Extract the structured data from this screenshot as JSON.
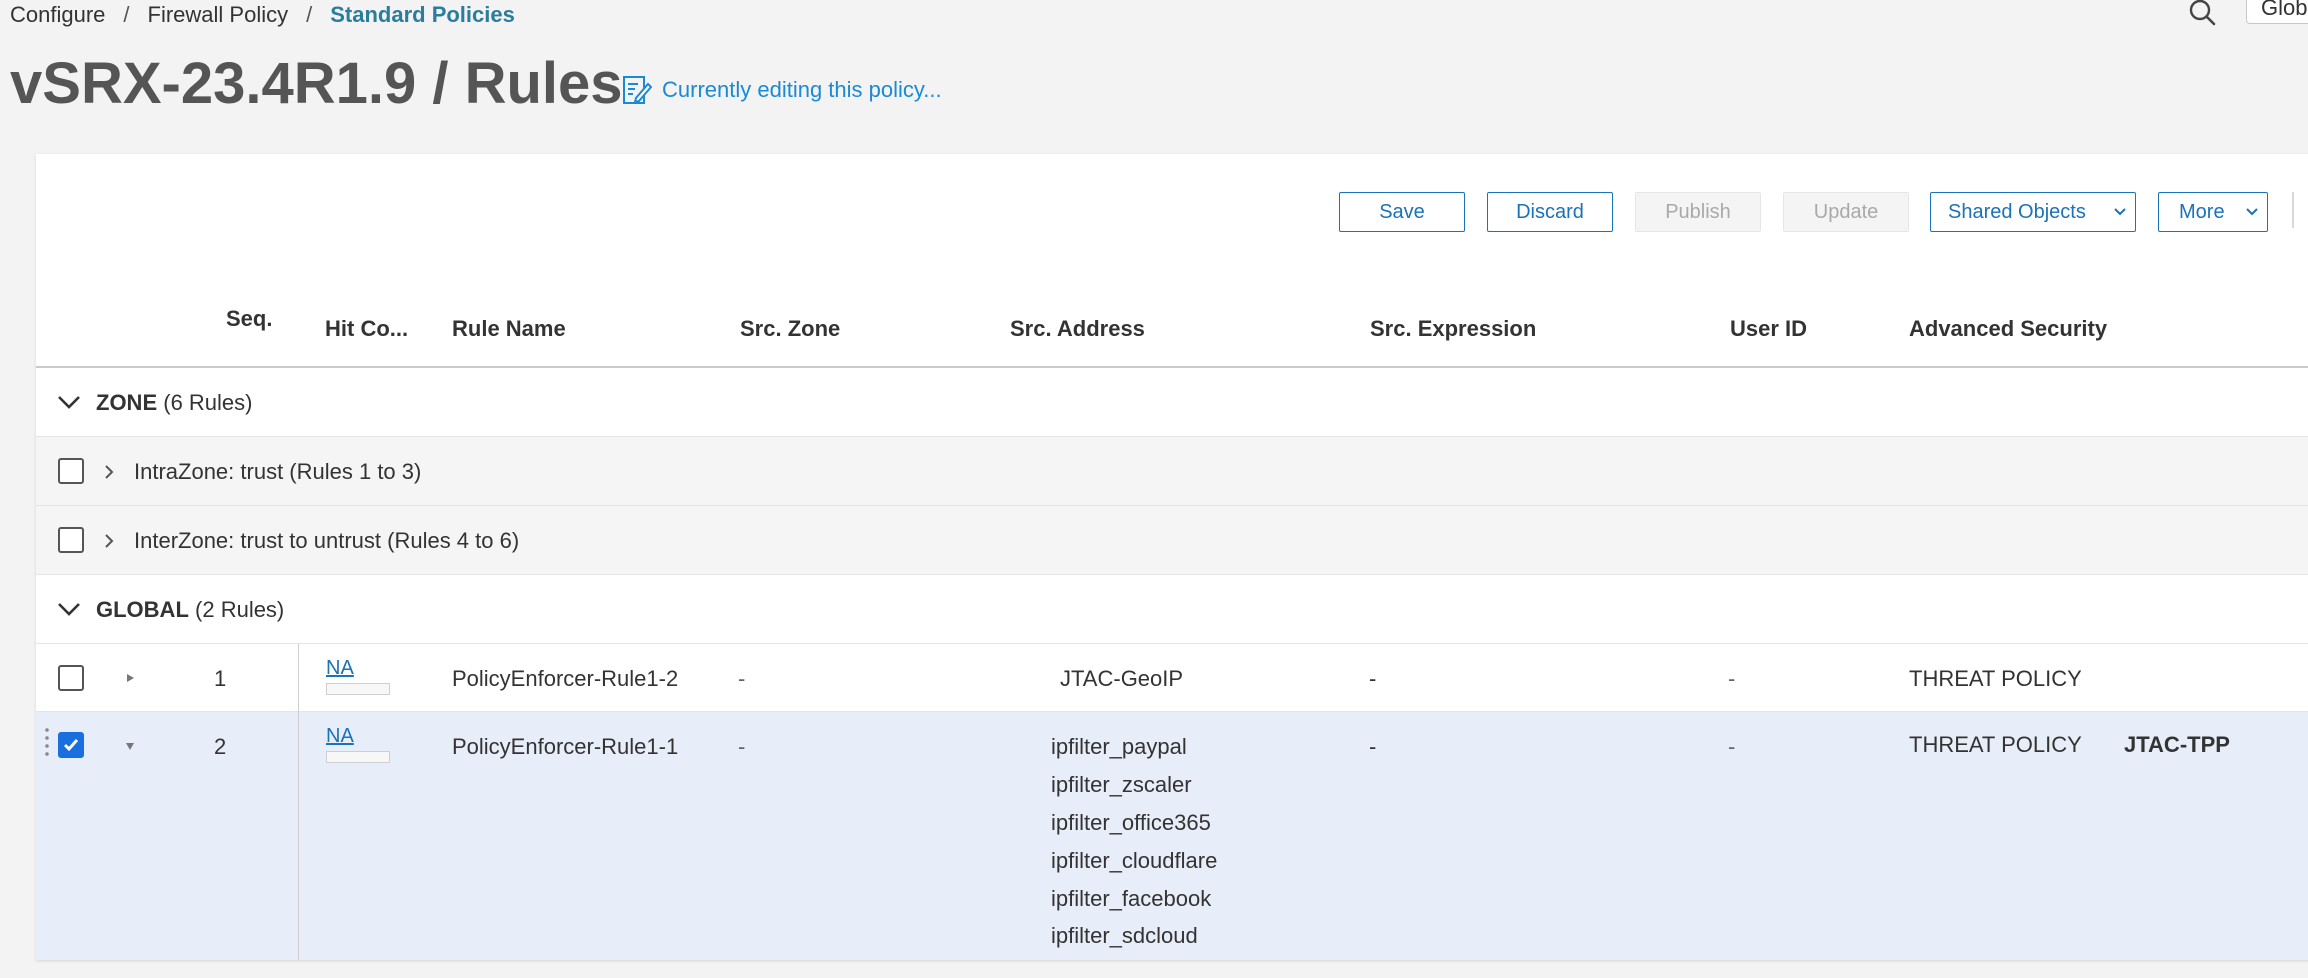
{
  "breadcrumb": {
    "items": [
      "Configure",
      "Firewall Policy"
    ],
    "current": "Standard Policies",
    "separator": "/"
  },
  "header": {
    "title": "vSRX-23.4R1.9 / Rules",
    "editing_label": "Currently editing this policy...",
    "global_label": "Glob"
  },
  "toolbar": {
    "save": "Save",
    "discard": "Discard",
    "publish": "Publish",
    "update": "Update",
    "shared_objects": "Shared Objects",
    "more": "More"
  },
  "columns": {
    "seq": "Seq.",
    "hit_count": "Hit Co...",
    "rule_name": "Rule Name",
    "src_zone": "Src. Zone",
    "src_address": "Src. Address",
    "src_expression": "Src. Expression",
    "user_id": "User ID",
    "advanced_security": "Advanced Security"
  },
  "groups": {
    "zone": {
      "name": "ZONE",
      "count": "(6 Rules)"
    },
    "global": {
      "name": "GLOBAL",
      "count": "(2 Rules)"
    }
  },
  "zone_subgroups": [
    "IntraZone: trust (Rules 1 to 3)",
    "InterZone: trust to untrust (Rules 4 to 6)"
  ],
  "rules": [
    {
      "seq": "1",
      "hit": "NA",
      "name": "PolicyEnforcer-Rule1-2",
      "src_zone": "-",
      "src_address": [
        "JTAC-GeoIP"
      ],
      "src_expression": "-",
      "user_id": "-",
      "advanced_security": "THREAT POLICY",
      "threat_profile": "",
      "selected": false
    },
    {
      "seq": "2",
      "hit": "NA",
      "name": "PolicyEnforcer-Rule1-1",
      "src_zone": "-",
      "src_address": [
        "ipfilter_paypal",
        "ipfilter_zscaler",
        "ipfilter_office365",
        "ipfilter_cloudflare",
        "ipfilter_facebook",
        "ipfilter_sdcloud"
      ],
      "src_expression": "-",
      "user_id": "-",
      "advanced_security": "THREAT POLICY",
      "threat_profile": "JTAC-TPP",
      "selected": true
    }
  ],
  "colors": {
    "accent": "#1a72b8",
    "link": "#1a8ad4",
    "breadcrumb_current": "#2a7d9b",
    "selected_row": "#e8eef9",
    "checkbox_checked": "#1a6fe0"
  }
}
